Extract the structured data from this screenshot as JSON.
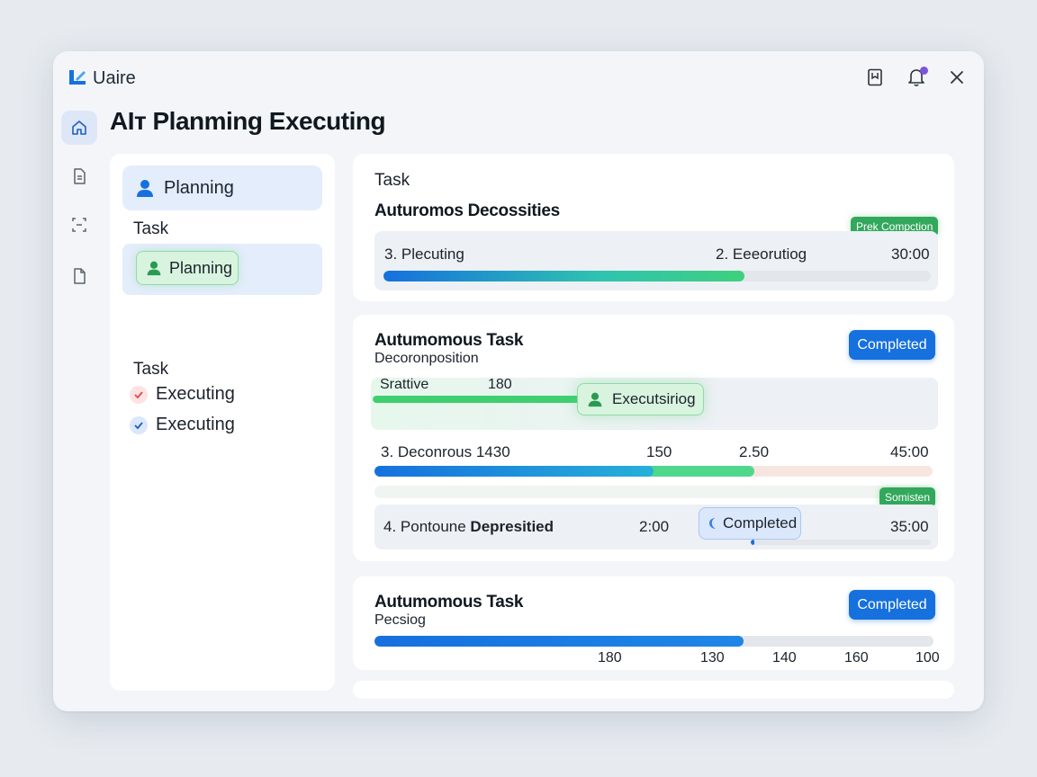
{
  "app": {
    "name": "Uaire"
  },
  "page": {
    "title": "AIт Planming Executing"
  },
  "left_panel": {
    "header": "Planning",
    "section1_label": "Task",
    "selected_chip": "Planning",
    "section2_label": "Task",
    "items": [
      {
        "label": "Executing",
        "status": "error"
      },
      {
        "label": "Executing",
        "status": "done"
      }
    ]
  },
  "card1": {
    "label": "Task",
    "title": "Auturomos Decossities",
    "badge": "Prek Compction",
    "row": {
      "left": "3. Plecuting",
      "mid": "2. Eeeorutiog",
      "right": "30:00",
      "progress": 0.66
    }
  },
  "card2": {
    "title": "Autumomous Task",
    "subtitle": "Decoronposition",
    "button": "Completed",
    "row1": {
      "left": "Srattive",
      "value": "180",
      "chip": "Executsiriog",
      "progress": 0.4
    },
    "row2": {
      "left": "3. Deconrous 1430",
      "v1": "150",
      "v2": "2.50",
      "right": "45:00",
      "progress_blue": 0.5,
      "progress_green": 0.68
    },
    "badge": "Somisten",
    "row3": {
      "left_plain": "4. Pontoune ",
      "left_bold": "Depresitied",
      "v1": "2:00",
      "chip": "Completed",
      "right": "35:00"
    }
  },
  "card3": {
    "title": "Autumomous Task",
    "subtitle": "Pecsiog",
    "button": "Completed",
    "progress": 0.66,
    "ticks": [
      "180",
      "130",
      "140",
      "160",
      "100"
    ]
  },
  "colors": {
    "accent_blue": "#1670de",
    "accent_green": "#32a85c",
    "chip_green_bg": "#d8f4df",
    "window_bg": "#f3f5f8"
  },
  "icons": {
    "titlebar": [
      "bookmark-icon",
      "bell-icon",
      "close-icon"
    ],
    "rail": [
      "home-icon",
      "document-icon",
      "scan-icon",
      "file-icon"
    ]
  }
}
